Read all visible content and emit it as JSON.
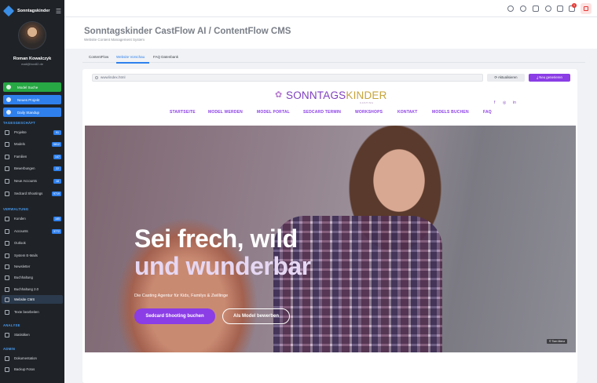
{
  "sidebar": {
    "brand": "Sonntagskinder",
    "user_name": "Roman Kowalczyk",
    "user_email": "mail@box82.de",
    "quick_actions": [
      {
        "label": "Model Suche"
      },
      {
        "label": "Neues Projekt"
      },
      {
        "label": "Daily Standup"
      }
    ],
    "sections": [
      {
        "title": "TAGESGESCHÄFT"
      },
      {
        "title": "VERWALTUNG"
      },
      {
        "title": "ANALYSE"
      },
      {
        "title": "ADMIN"
      }
    ],
    "items": [
      {
        "label": "Projekte",
        "badge": "91"
      },
      {
        "label": "Models",
        "badge": "5812"
      },
      {
        "label": "Familien",
        "badge": "147"
      },
      {
        "label": "Bewerbungen",
        "badge": "22"
      },
      {
        "label": "Neue Accounts",
        "badge": "18"
      },
      {
        "label": "Sedcard Shootings",
        "badge": "9719"
      },
      {
        "label": "Kunden",
        "badge": "185"
      },
      {
        "label": "Accounts",
        "badge": "3772"
      },
      {
        "label": "Outlook",
        "badge": ""
      },
      {
        "label": "System E-Mails",
        "badge": ""
      },
      {
        "label": "Newsletter",
        "badge": ""
      },
      {
        "label": "Buchhaltung",
        "badge": ""
      },
      {
        "label": "Buchhaltung 2.0",
        "badge": ""
      },
      {
        "label": "Website CMS",
        "badge": ""
      },
      {
        "label": "Texte bearbeiten",
        "badge": ""
      },
      {
        "label": "Statistiken",
        "badge": ""
      },
      {
        "label": "Dokumentation",
        "badge": ""
      },
      {
        "label": "Backup Fotos",
        "badge": ""
      }
    ]
  },
  "topbar": {
    "notification_count": "1"
  },
  "page": {
    "title": "Sonntagskinder CastFlow AI / ContentFlow CMS",
    "subtitle": "Website Content Management System",
    "tabs": [
      {
        "label": "ContentFlow"
      },
      {
        "label": "Website Vorschau"
      },
      {
        "label": "FAQ Datenbank"
      }
    ]
  },
  "preview": {
    "url": "www/index.html",
    "refresh_label": "Aktualisieren",
    "generate_label": "Neu generieren",
    "logo_text_a": "SONNTAGS",
    "logo_text_b": "KINDER",
    "logo_tagline": "CASTING",
    "nav": [
      "STARTSEITE",
      "MODEL WERDEN",
      "MODEL PORTAL",
      "SEDCARD TERMIN",
      "WORKSHOPS",
      "KONTAKT",
      "MODELS BUCHEN",
      "FAQ"
    ],
    "social": [
      "f",
      "◎",
      "in"
    ],
    "hero": {
      "line1": "Sei frech, wild",
      "line2": "und wunderbar",
      "sub": "Die Casting Agentur für Kids, Familys & Zwillinge",
      "btn_primary": "Sedcard Shooting buchen",
      "btn_secondary": "Als Model bewerben",
      "credit": "© Tom Menz"
    }
  },
  "colors": {
    "sidebar_bg": "#1f2328",
    "accent_blue": "#2f80ed",
    "accent_green": "#27a844",
    "brand_purple": "#8b3de6",
    "logo_gold": "#c7a33a"
  }
}
